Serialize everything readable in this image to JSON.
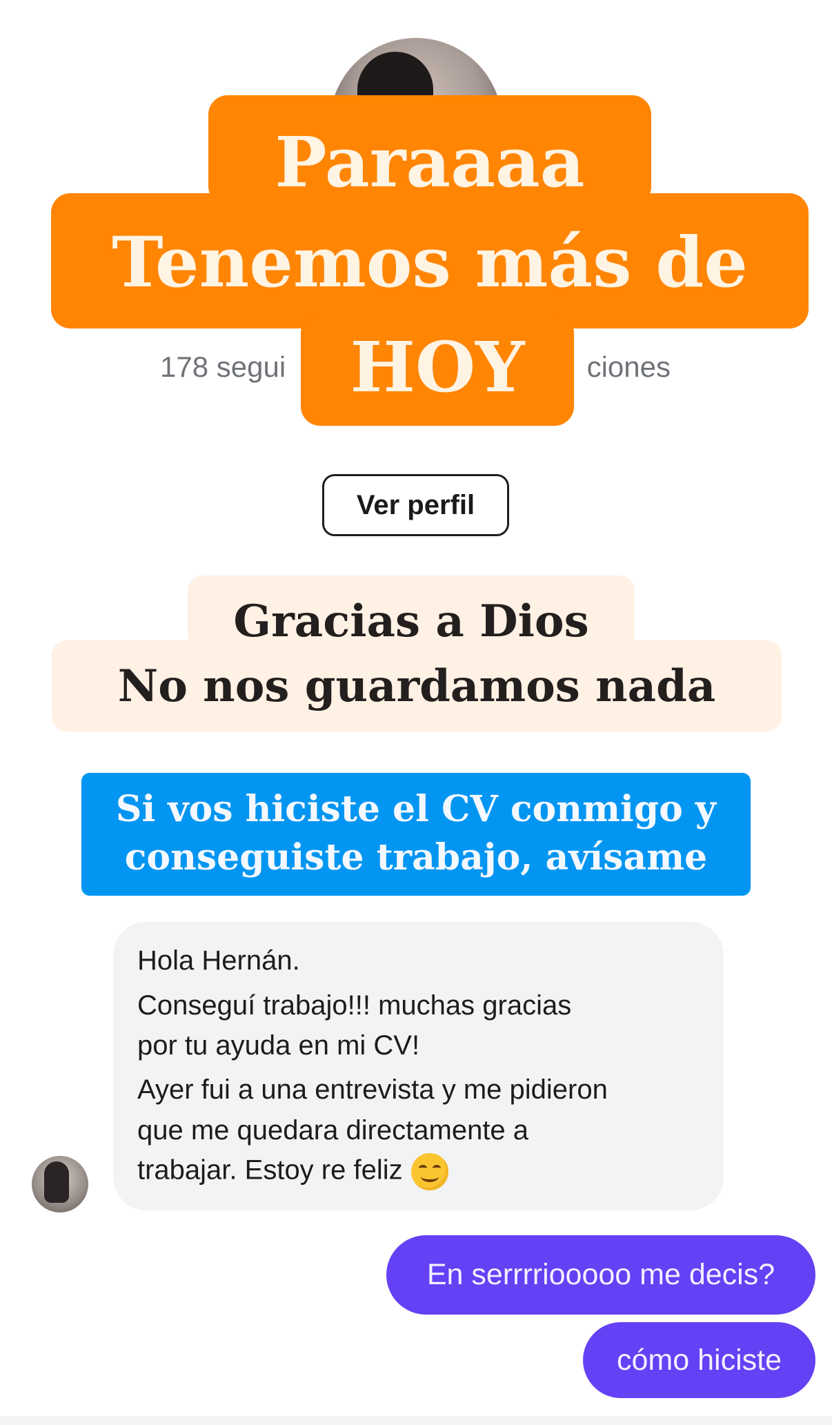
{
  "profile": {
    "stats_left": "178 segui",
    "stats_right": "ciones",
    "view_profile_button": "Ver perfil"
  },
  "overlay_orange": {
    "line1": "Paraaaa",
    "line2": "Tenemos más de",
    "line3": "HOY",
    "color": "#ff8503"
  },
  "overlay_cream": {
    "line1": "Gracias a Dios",
    "line2": "No nos guardamos nada",
    "color": "#fff1e4"
  },
  "overlay_blue": {
    "line1": "Si vos hiciste el CV conmigo y",
    "line2": "conseguiste trabajo, avísame",
    "color": "#0296f2"
  },
  "conversation": {
    "incoming": {
      "lines": [
        "Hola Hernán.",
        "Conseguí trabajo!!! muchas gracias",
        "por tu ayuda en mi CV!",
        "Ayer fui a una entrevista y me pidieron",
        "que me quedara directamente a",
        "trabajar. Estoy re feliz"
      ],
      "emoji": "smiling-face"
    },
    "outgoing": [
      "En serrrriooooo me decis?",
      "cómo hiciste"
    ],
    "outgoing_color": "#6441f5"
  }
}
